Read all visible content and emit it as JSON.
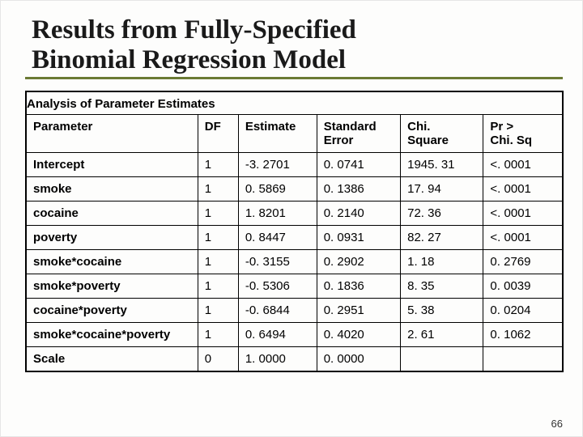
{
  "title_line1": "Results from Fully-Specified",
  "title_line2": "Binomial Regression Model",
  "page_number": "66",
  "chart_data": {
    "type": "table",
    "title": "Analysis of Parameter Estimates",
    "columns": [
      "Parameter",
      "DF",
      "Estimate",
      "Standard Error",
      "Chi. Square",
      "Pr > Chi. Sq"
    ],
    "rows": [
      {
        "parameter": "Intercept",
        "df": "1",
        "estimate": "-3. 2701",
        "se": "0. 0741",
        "chi": "1945. 31",
        "pr": "<. 0001"
      },
      {
        "parameter": "smoke",
        "df": "1",
        "estimate": "0. 5869",
        "se": "0. 1386",
        "chi": "17. 94",
        "pr": "<. 0001"
      },
      {
        "parameter": "cocaine",
        "df": "1",
        "estimate": "1. 8201",
        "se": "0. 2140",
        "chi": "72. 36",
        "pr": "<. 0001"
      },
      {
        "parameter": "poverty",
        "df": "1",
        "estimate": "0. 8447",
        "se": "0. 0931",
        "chi": "82. 27",
        "pr": "<. 0001"
      },
      {
        "parameter": "smoke*cocaine",
        "df": "1",
        "estimate": "-0. 3155",
        "se": "0. 2902",
        "chi": "1. 18",
        "pr": "0. 2769"
      },
      {
        "parameter": "smoke*poverty",
        "df": "1",
        "estimate": "-0. 5306",
        "se": "0. 1836",
        "chi": "8. 35",
        "pr": "0. 0039"
      },
      {
        "parameter": "cocaine*poverty",
        "df": "1",
        "estimate": "-0. 6844",
        "se": "0. 2951",
        "chi": "5. 38",
        "pr": "0. 0204"
      },
      {
        "parameter": "smoke*cocaine*poverty",
        "df": "1",
        "estimate": "0. 6494",
        "se": "0. 4020",
        "chi": "2. 61",
        "pr": "0. 1062"
      },
      {
        "parameter": "Scale",
        "df": "0",
        "estimate": "1. 0000",
        "se": "0. 0000",
        "chi": "",
        "pr": ""
      }
    ]
  }
}
